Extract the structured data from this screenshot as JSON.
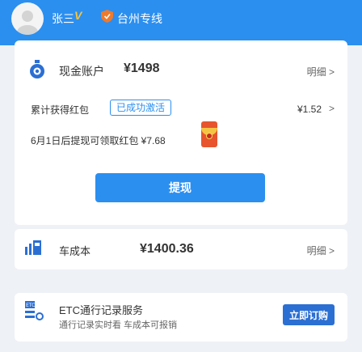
{
  "header": {
    "user_name": "张三",
    "vip_badge": "V",
    "line_name": "台州专线"
  },
  "account": {
    "label": "现金账户",
    "amount": "¥1498",
    "detail": "明细 >"
  },
  "rewards": {
    "label": "累计获得红包",
    "status": "已成功激活",
    "amount": "¥1.52",
    "arrow": ">",
    "cash_note": "6月1日后提现可领取红包 ¥7.68"
  },
  "withdraw_button": "提现",
  "cost": {
    "label": "车成本",
    "amount": "¥1400.36",
    "detail": "明细 >"
  },
  "etc": {
    "title": "ETC通行记录服务",
    "subtitle": "通行记录实时看 车成本可报销",
    "button": "立即订购"
  },
  "colors": {
    "primary": "#2b8ff0",
    "badge_gold": "#f7c43b",
    "shield_orange": "#ee7a2c"
  }
}
